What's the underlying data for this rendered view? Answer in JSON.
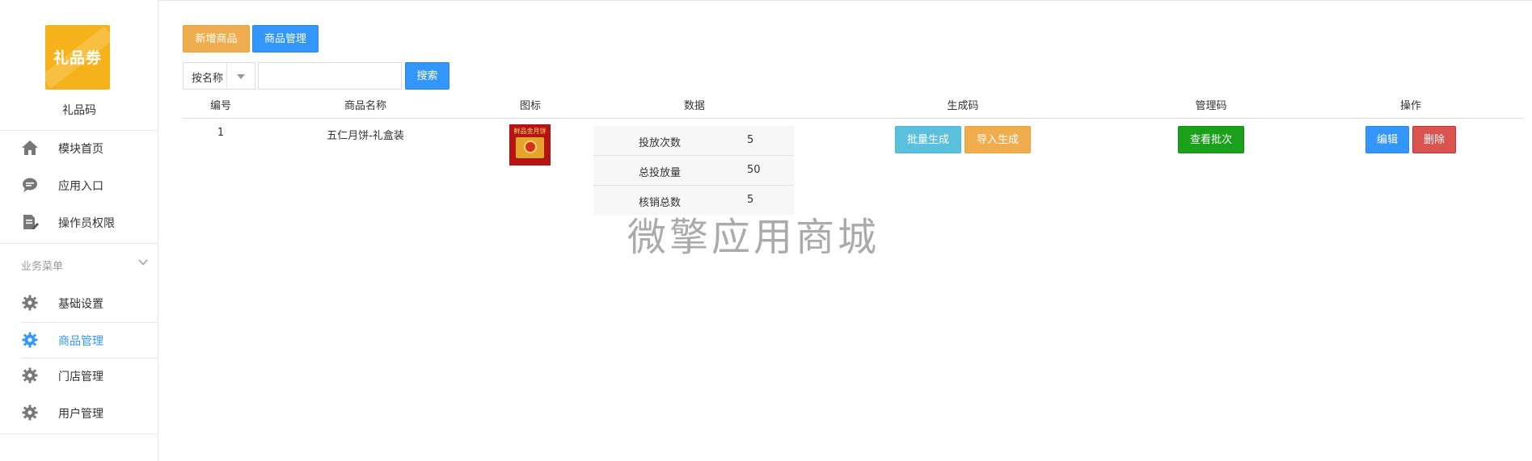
{
  "sidebar": {
    "logo_text": "礼品劵",
    "app_name": "礼品码",
    "top_items": [
      {
        "label": "模块首页",
        "icon": "home-icon"
      },
      {
        "label": "应用入口",
        "icon": "chat-icon"
      },
      {
        "label": "操作员权限",
        "icon": "document-edit-icon"
      }
    ],
    "group_title": "业务菜单",
    "group_items": [
      {
        "label": "基础设置",
        "icon": "gear-icon"
      },
      {
        "label": "商品管理",
        "icon": "gear-icon",
        "active": true
      },
      {
        "label": "门店管理",
        "icon": "gear-icon"
      },
      {
        "label": "用户管理",
        "icon": "gear-icon"
      }
    ]
  },
  "toolbar": {
    "add_product": "新增商品",
    "product_manage": "商品管理",
    "filter_select": "按名称",
    "search_placeholder": "",
    "search_button": "搜索"
  },
  "table": {
    "headers": [
      "编号",
      "商品名称",
      "图标",
      "数据",
      "生成码",
      "管理码",
      "操作"
    ],
    "rows": [
      {
        "id": "1",
        "name": "五仁月饼-礼盒装",
        "image_text": "鲜品金月饼",
        "stats": [
          {
            "label": "投放次数",
            "value": "5"
          },
          {
            "label": "总投放量",
            "value": "50"
          },
          {
            "label": "核销总数",
            "value": "5"
          }
        ],
        "generate_actions": [
          "批量生成",
          "导入生成"
        ],
        "manage_action": "查看批次",
        "ops": [
          "编辑",
          "删除"
        ]
      }
    ]
  },
  "watermark": "微擎应用商城",
  "colors": {
    "accent_blue": "#3296fa",
    "orange": "#f0ad4e",
    "cyan": "#5bc0de",
    "green": "#1aa01a",
    "red": "#d9534f",
    "logo_yellow": "#f6b21a"
  }
}
